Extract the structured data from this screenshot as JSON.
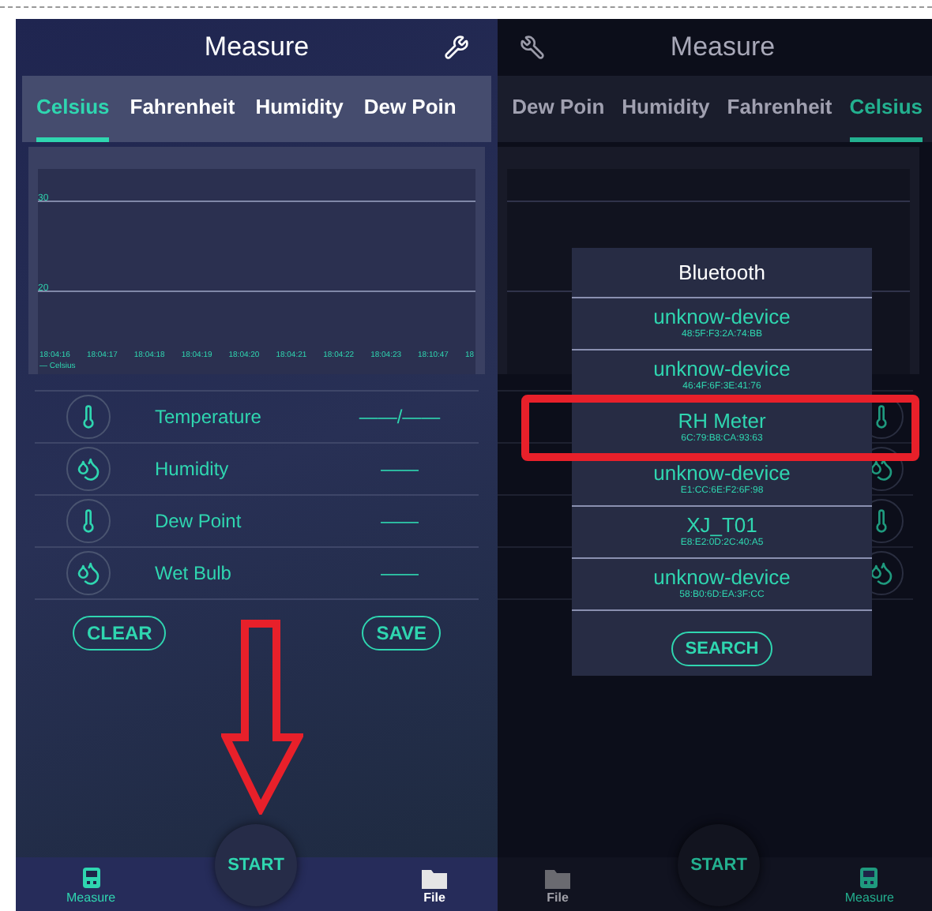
{
  "left_screen": {
    "dimmed": false,
    "header": {
      "title": "Measure"
    },
    "tabs": [
      {
        "label": "Celsius",
        "selected": true
      },
      {
        "label": "Fahrenheit",
        "selected": false
      },
      {
        "label": "Humidity",
        "selected": false
      },
      {
        "label": "Dew Poin",
        "selected": false
      }
    ],
    "chart": {
      "y_labels": [
        "30",
        "20"
      ],
      "x_labels": [
        "18:04:16",
        "18:04:17",
        "18:04:18",
        "18:04:19",
        "18:04:20",
        "18:04:21",
        "18:04:22",
        "18:04:23",
        "18:10:47",
        "18"
      ],
      "legend": "— Celsius"
    },
    "readings": [
      {
        "kind": "thermometer",
        "label": "Temperature",
        "value": "——/——"
      },
      {
        "kind": "droplets",
        "label": "Humidity",
        "value": "——"
      },
      {
        "kind": "thermometer",
        "label": "Dew Point",
        "value": "——"
      },
      {
        "kind": "droplets",
        "label": "Wet Bulb",
        "value": "——"
      }
    ],
    "buttons": [
      "CLEAR",
      "SAVE"
    ],
    "start_button": "START",
    "nav": [
      {
        "kind": "meter",
        "label": "Measure",
        "selected": true
      },
      {
        "kind": "folder",
        "label": "File",
        "selected": false
      }
    ]
  },
  "right_screen": {
    "dimmed": true,
    "header": {
      "title": "Measure"
    },
    "tabs": [
      {
        "label": "Dew Poin",
        "selected": false
      },
      {
        "label": "Humidity",
        "selected": false
      },
      {
        "label": "Fahrenheit",
        "selected": false
      },
      {
        "label": "Celsius",
        "selected": true
      }
    ],
    "readings": [
      {
        "kind": "thermometer"
      },
      {
        "kind": "droplets"
      },
      {
        "kind": "thermometer"
      },
      {
        "kind": "droplets"
      }
    ],
    "start_button": "START",
    "nav": [
      {
        "kind": "folder",
        "label": "File",
        "selected": false
      },
      {
        "kind": "meter",
        "label": "Measure",
        "selected": true
      }
    ],
    "dialog": {
      "title": "Bluetooth",
      "devices": [
        {
          "name": "unknow-device",
          "address": "48:5F:F3:2A:74:BB",
          "highlighted": false
        },
        {
          "name": "unknow-device",
          "address": "46:4F:6F:3E:41:76",
          "highlighted": false
        },
        {
          "name": "RH Meter",
          "address": "6C:79:B8:CA:93:63",
          "highlighted": true
        },
        {
          "name": "unknow-device",
          "address": "E1:CC:6E:F2:6F:98",
          "highlighted": false
        },
        {
          "name": "XJ_T01",
          "address": "E8:E2:0D:2C:40:A5",
          "highlighted": false
        },
        {
          "name": "unknow-device",
          "address": "58:B0:6D:EA:3F:CC",
          "highlighted": false
        }
      ],
      "search_button": "SEARCH"
    }
  }
}
